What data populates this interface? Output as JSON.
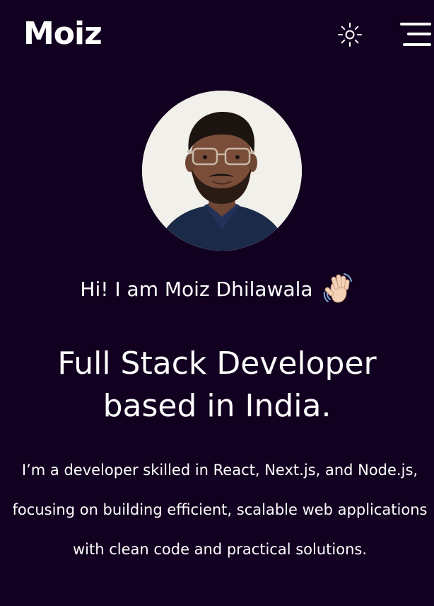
{
  "header": {
    "logo_text": "Moiz",
    "theme_toggle_icon": "sun-icon",
    "menu_icon": "hamburger-menu-icon"
  },
  "hero": {
    "avatar_alt": "profile-photo",
    "greeting": "Hi! I am Moiz Dhilawala",
    "greeting_emoji": "waving-hand-emoji",
    "headline_line1": "Full Stack Developer",
    "headline_line2": "based in India.",
    "bio": "I’m a developer skilled in React, Next.js, and Node.js, focusing on building efficient, scalable web applications with clean code and practical solutions."
  },
  "colors": {
    "background": "#11001f",
    "text": "#ffffff",
    "avatar_background": "#f1f0ea",
    "skin_tone": "#f3d2b8"
  }
}
